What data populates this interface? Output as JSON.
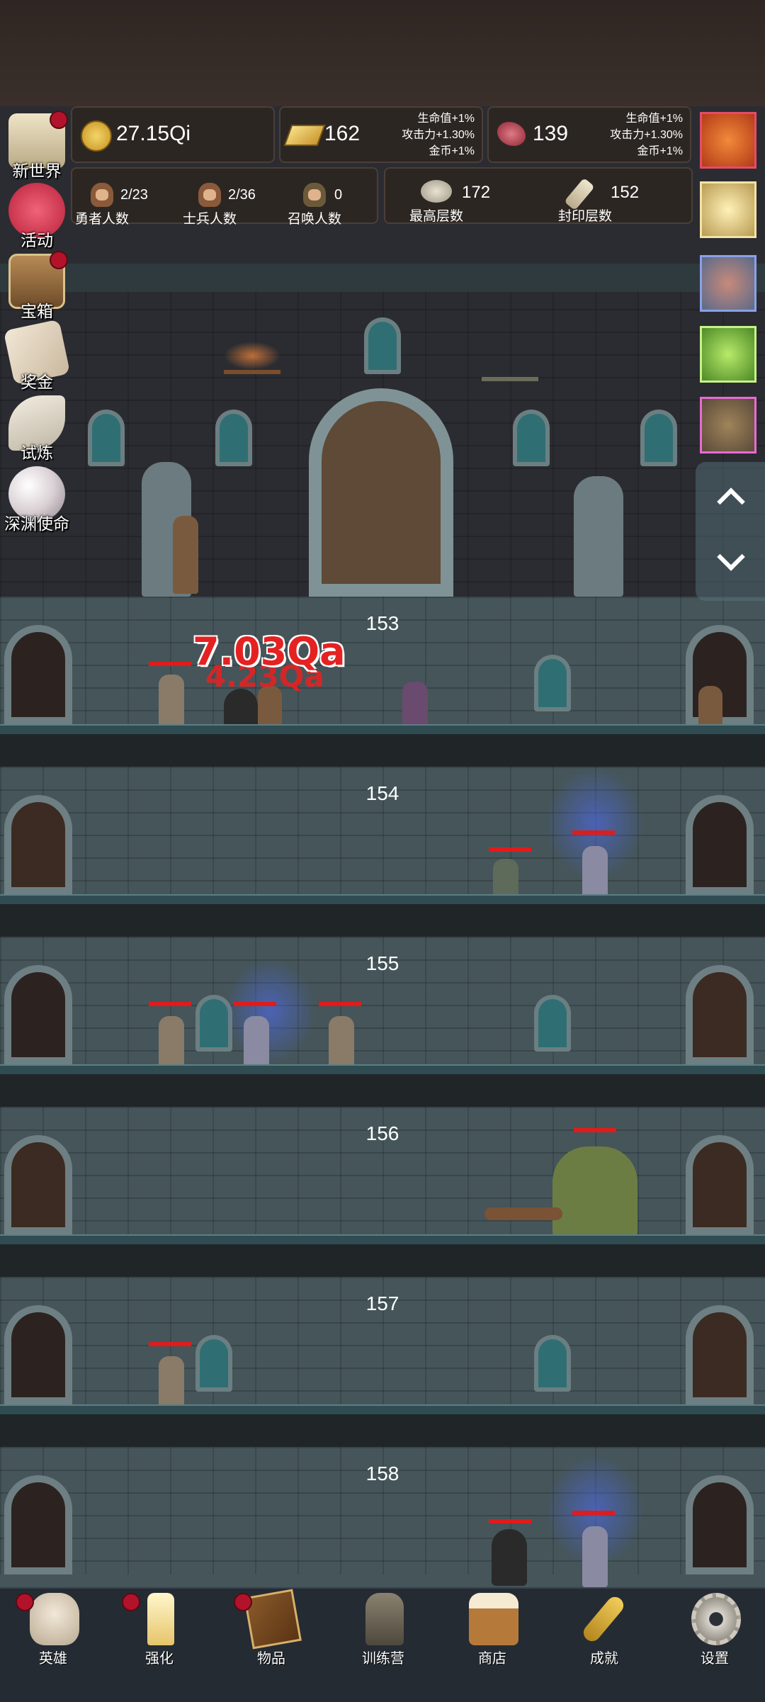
{
  "resources": {
    "gold": {
      "value": "27.15Qi"
    },
    "bars": {
      "value": "162",
      "bonus": [
        "生命值+1%",
        "攻击力+1.30%",
        "金币+1%"
      ]
    },
    "meat": {
      "value": "139",
      "bonus": [
        "生命值+1%",
        "攻击力+1.30%",
        "金币+1%"
      ]
    }
  },
  "counts": {
    "heroes": {
      "value": "2/23",
      "label": "勇者人数"
    },
    "soldiers": {
      "value": "2/36",
      "label": "士兵人数"
    },
    "summons": {
      "value": "0",
      "label": "召唤人数"
    },
    "highest": {
      "value": "172",
      "label": "最高层数"
    },
    "sealed": {
      "value": "152",
      "label": "封印层数"
    }
  },
  "left_menu": [
    {
      "label": "新世界",
      "icon": "scroll-map-icon",
      "badge": true
    },
    {
      "label": "活动",
      "icon": "heart-icon",
      "badge": false
    },
    {
      "label": "宝箱",
      "icon": "treasure-chest-icon",
      "badge": true
    },
    {
      "label": "奖金",
      "icon": "envelope-icon",
      "badge": false
    },
    {
      "label": "试炼",
      "icon": "feather-icon",
      "badge": false
    },
    {
      "label": "深渊使命",
      "icon": "pearl-icon",
      "badge": false
    }
  ],
  "right_boosts": [
    {
      "icon": "apple-icon"
    },
    {
      "icon": "candle-icon"
    },
    {
      "icon": "meat-icon"
    },
    {
      "icon": "slime-icon"
    },
    {
      "icon": "goblin-face-icon"
    }
  ],
  "damage_popup": {
    "main": "7.03Qa",
    "shadow": "4.23Qa"
  },
  "floors": [
    {
      "number": "153"
    },
    {
      "number": "154"
    },
    {
      "number": "155"
    },
    {
      "number": "156"
    },
    {
      "number": "157"
    },
    {
      "number": "158"
    }
  ],
  "bottom_nav": [
    {
      "label": "英雄",
      "icon": "skull-icon",
      "badge": true
    },
    {
      "label": "强化",
      "icon": "candle-icon",
      "badge": true
    },
    {
      "label": "物品",
      "icon": "book-icon",
      "badge": true
    },
    {
      "label": "训练营",
      "icon": "lantern-icon",
      "badge": false
    },
    {
      "label": "商店",
      "icon": "beer-mug-icon",
      "badge": false
    },
    {
      "label": "成就",
      "icon": "key-icon",
      "badge": false
    },
    {
      "label": "设置",
      "icon": "gear-icon",
      "badge": false
    }
  ],
  "colors": {
    "hp_bar": "#e11b1b",
    "badge": "#b3122b",
    "magic_glow": "#5070ff"
  }
}
